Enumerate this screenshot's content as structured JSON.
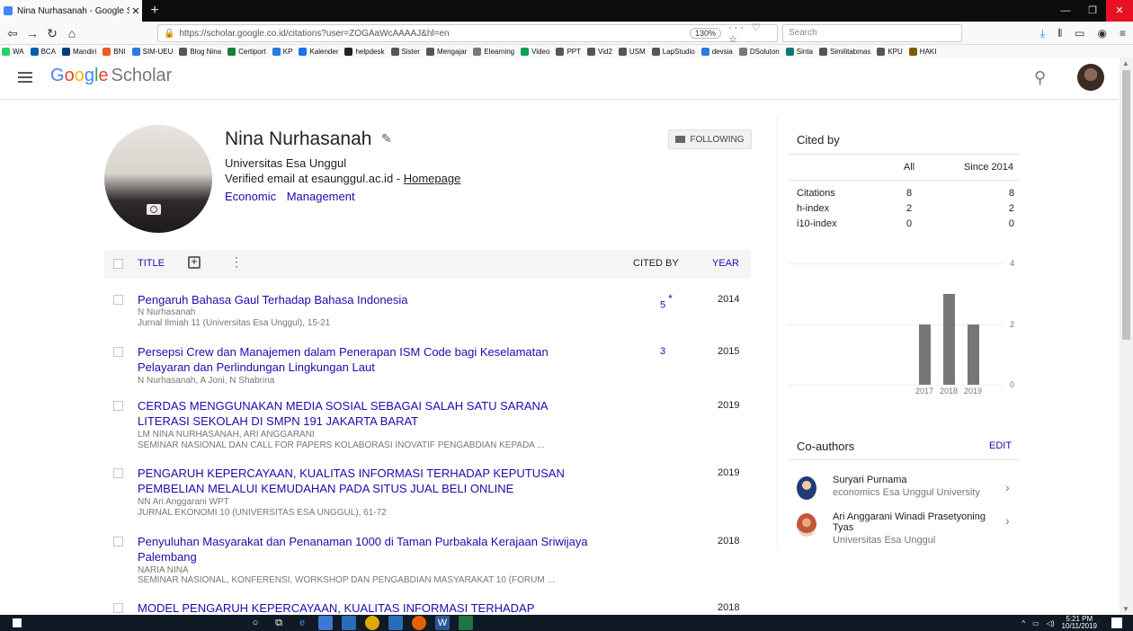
{
  "browser": {
    "tab_title": "Nina Nurhasanah - Google Sch",
    "tab_close": "✕",
    "new_tab": "+",
    "url": "https://scholar.google.co.id/citations?user=ZOGAaWcAAAAJ&hl=en",
    "zoom": "130%",
    "page_actions": "··· ♡ ☆",
    "search_placeholder": "Search",
    "bookmarks": [
      {
        "label": "WA",
        "color": "#25d366"
      },
      {
        "label": "BCA",
        "color": "#0060af"
      },
      {
        "label": "Mandiri",
        "color": "#003d79"
      },
      {
        "label": "BNI",
        "color": "#f15a23"
      },
      {
        "label": "SIM-UEU",
        "color": "#2a7ae2"
      },
      {
        "label": "Blog Nina",
        "color": "#555555"
      },
      {
        "label": "Certiport",
        "color": "#1a7f37"
      },
      {
        "label": "KP",
        "color": "#2a7ae2"
      },
      {
        "label": "Kalender",
        "color": "#1a73e8"
      },
      {
        "label": "helpdesk",
        "color": "#222222"
      },
      {
        "label": "Sister",
        "color": "#555555"
      },
      {
        "label": "Mengajar",
        "color": "#555555"
      },
      {
        "label": "Elearning",
        "color": "#777777"
      },
      {
        "label": "Video",
        "color": "#0f9d58"
      },
      {
        "label": "PPT",
        "color": "#555555"
      },
      {
        "label": "Vid2",
        "color": "#555555"
      },
      {
        "label": "USM",
        "color": "#555555"
      },
      {
        "label": "LapStudio",
        "color": "#555555"
      },
      {
        "label": "devsia",
        "color": "#2a7ae2"
      },
      {
        "label": "DSoluton",
        "color": "#777777"
      },
      {
        "label": "Sinta",
        "color": "#0b7a75"
      },
      {
        "label": "Similitabmas",
        "color": "#555555"
      },
      {
        "label": "KPU",
        "color": "#555555"
      },
      {
        "label": "HAKI",
        "color": "#7a5c00"
      }
    ]
  },
  "header": {
    "logo_g": "G",
    "logo_o1": "o",
    "logo_o2": "o",
    "logo_g2": "g",
    "logo_l": "l",
    "logo_e": "e",
    "logo_scholar": "Scholar"
  },
  "profile": {
    "name": "Nina Nurhasanah",
    "edit_icon": "✎",
    "affiliation": "Universitas Esa Unggul",
    "verified": "Verified email at esaunggul.ac.id - ",
    "homepage": "Homepage",
    "interests": [
      "Economic",
      "Management"
    ],
    "follow_label": "FOLLOWING"
  },
  "table": {
    "col_title": "TITLE",
    "col_add": "+",
    "col_more": "⋮",
    "col_cited": "CITED BY",
    "col_year": "YEAR",
    "rows": [
      {
        "title": "Pengaruh Bahasa Gaul Terhadap Bahasa Indonesia",
        "authors": "N Nurhasanah",
        "venue": "Jurnal Ilmiah 11 (Universitas Esa Unggul), 15-21",
        "cited": "5",
        "star": "*",
        "year": "2014"
      },
      {
        "title": "Persepsi Crew dan Manajemen dalam Penerapan ISM Code bagi Keselamatan Pelayaran dan Perlindungan Lingkungan Laut",
        "authors": "N Nurhasanah, A Joni, N Shabrina",
        "venue": "",
        "cited": "3",
        "star": "",
        "year": "2015"
      },
      {
        "title": "CERDAS MENGGUNAKAN MEDIA SOSIAL SEBAGAI SALAH SATU SARANA LITERASI SEKOLAH DI SMPN 191 JAKARTA BARAT",
        "authors": "LM NINA NURHASANAH, ARI ANGGARANI",
        "venue": "SEMINAR NASIONAL DAN CALL FOR PAPERS KOLABORASI INOVATIF PENGABDIAN KEPADA ...",
        "cited": "",
        "star": "",
        "year": "2019"
      },
      {
        "title": "PENGARUH KEPERCAYAAN, KUALITAS INFORMASI TERHADAP KEPUTUSAN PEMBELIAN MELALUI KEMUDAHAN PADA SITUS JUAL BELI ONLINE",
        "authors": "NN Ari Anggarani WPT",
        "venue": "JURNAL EKONOMI 10 (UNIVERSITAS ESA UNGGUL), 61-72",
        "cited": "",
        "star": "",
        "year": "2019"
      },
      {
        "title": "Penyuluhan Masyarakat dan Penanaman 1000 di Taman Purbakala Kerajaan Sriwijaya Palembang",
        "authors": "NARIA NINA",
        "venue": "SEMINAR NASIONAL, KONFERENSI, WORKSHOP DAN PENGABDIAN MASYARAKAT 10 (FORUM ...",
        "cited": "",
        "star": "",
        "year": "2018"
      },
      {
        "title": "MODEL PENGARUH KEPERCAYAAN, KUALITAS INFORMASI TERHADAP",
        "authors": "",
        "venue": "",
        "cited": "",
        "star": "",
        "year": "2018"
      }
    ]
  },
  "cited_by": {
    "title": "Cited by",
    "col_all": "All",
    "col_since": "Since 2014",
    "rows": [
      {
        "label": "Citations",
        "all": "8",
        "since": "8"
      },
      {
        "label": "h-index",
        "all": "2",
        "since": "2"
      },
      {
        "label": "i10-index",
        "all": "0",
        "since": "0"
      }
    ]
  },
  "chart_data": {
    "type": "bar",
    "categories": [
      "2017",
      "2018",
      "2019"
    ],
    "values": [
      2,
      3,
      2
    ],
    "ylim": [
      0,
      4
    ],
    "yticks": [
      "4",
      "2",
      "0"
    ],
    "bar_color": "#777777"
  },
  "coauthors": {
    "title": "Co-authors",
    "edit": "EDIT",
    "list": [
      {
        "name": "Suryari Purnama",
        "affiliation": "economics Esa Unggul University"
      },
      {
        "name": "Ari Anggarani Winadi Prasetyoning Tyas",
        "affiliation": "Universitas Esa Unggul"
      }
    ]
  },
  "taskbar": {
    "clock_time": "5:21 PM",
    "clock_date": "10/11/2019"
  }
}
